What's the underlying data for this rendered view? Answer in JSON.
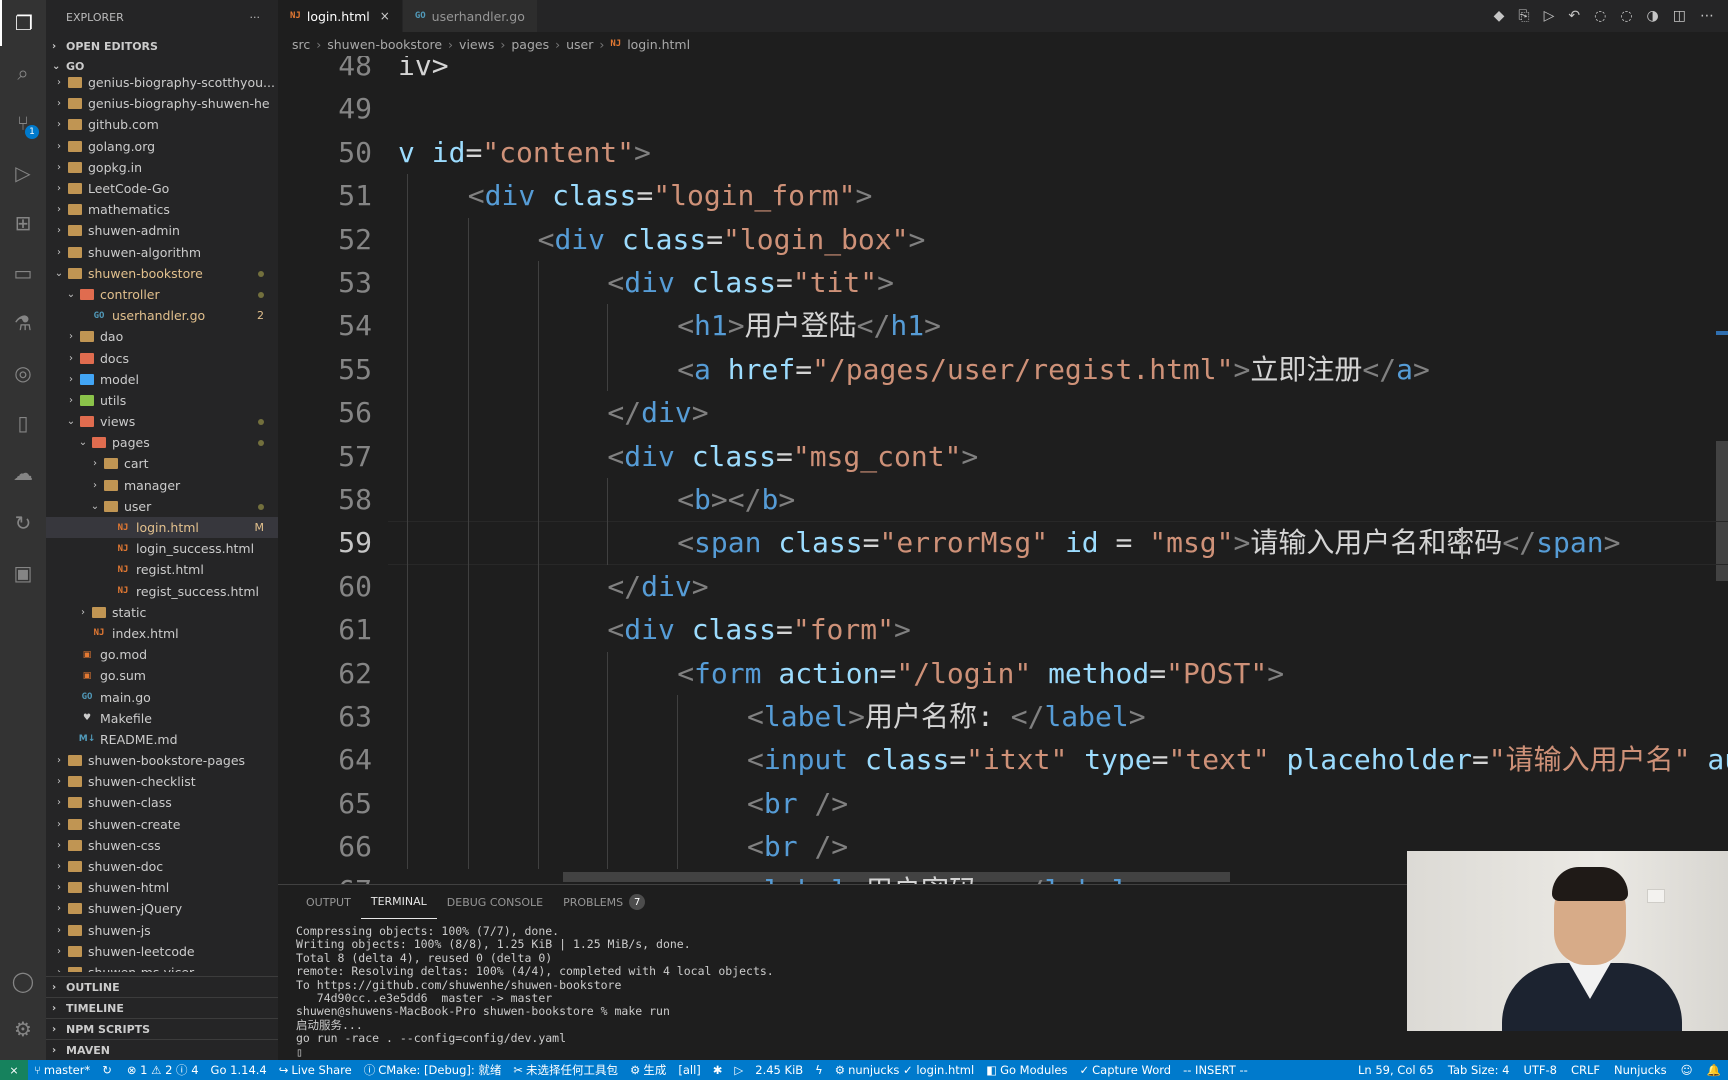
{
  "sidebar": {
    "title": "EXPLORER",
    "more": "···",
    "open_editors": "OPEN EDITORS",
    "workspace": "GO",
    "tree": [
      {
        "name": "genius-biography-scotthyou...",
        "type": "folder",
        "depth": 1,
        "open": false
      },
      {
        "name": "genius-biography-shuwen-he",
        "type": "folder",
        "depth": 1,
        "open": false
      },
      {
        "name": "github.com",
        "type": "folder",
        "depth": 1,
        "open": false
      },
      {
        "name": "golang.org",
        "type": "folder",
        "depth": 1,
        "open": false
      },
      {
        "name": "gopkg.in",
        "type": "folder",
        "depth": 1,
        "open": false
      },
      {
        "name": "LeetCode-Go",
        "type": "folder",
        "depth": 1,
        "open": false
      },
      {
        "name": "mathematics",
        "type": "folder",
        "depth": 1,
        "open": false
      },
      {
        "name": "shuwen-admin",
        "type": "folder",
        "depth": 1,
        "open": false
      },
      {
        "name": "shuwen-algorithm",
        "type": "folder",
        "depth": 1,
        "open": false
      },
      {
        "name": "shuwen-bookstore",
        "type": "folder",
        "depth": 1,
        "open": true,
        "modified": true,
        "deco": "dot"
      },
      {
        "name": "controller",
        "type": "folder-special",
        "depth": 2,
        "open": true,
        "modified": true,
        "deco": "dot"
      },
      {
        "name": "userhandler.go",
        "type": "go",
        "depth": 3,
        "modified": true,
        "deco": "2"
      },
      {
        "name": "dao",
        "type": "folder",
        "depth": 2,
        "open": false
      },
      {
        "name": "docs",
        "type": "folder-special",
        "depth": 2,
        "open": false
      },
      {
        "name": "model",
        "type": "folder-blue",
        "depth": 2,
        "open": false
      },
      {
        "name": "utils",
        "type": "folder-green",
        "depth": 2,
        "open": false
      },
      {
        "name": "views",
        "type": "folder-special",
        "depth": 2,
        "open": true,
        "deco": "dot"
      },
      {
        "name": "pages",
        "type": "folder-special",
        "depth": 3,
        "open": true,
        "deco": "dot"
      },
      {
        "name": "cart",
        "type": "folder",
        "depth": 4,
        "open": false
      },
      {
        "name": "manager",
        "type": "folder",
        "depth": 4,
        "open": false
      },
      {
        "name": "user",
        "type": "folder",
        "depth": 4,
        "open": true,
        "deco": "dot"
      },
      {
        "name": "login.html",
        "type": "html",
        "depth": 5,
        "selected": true,
        "modified": true,
        "deco": "M"
      },
      {
        "name": "login_success.html",
        "type": "html",
        "depth": 5
      },
      {
        "name": "regist.html",
        "type": "html",
        "depth": 5
      },
      {
        "name": "regist_success.html",
        "type": "html",
        "depth": 5
      },
      {
        "name": "static",
        "type": "folder",
        "depth": 3,
        "open": false
      },
      {
        "name": "index.html",
        "type": "html",
        "depth": 3
      },
      {
        "name": "go.mod",
        "type": "gomod",
        "depth": 2
      },
      {
        "name": "go.sum",
        "type": "gomod",
        "depth": 2
      },
      {
        "name": "main.go",
        "type": "go",
        "depth": 2
      },
      {
        "name": "Makefile",
        "type": "make",
        "depth": 2
      },
      {
        "name": "README.md",
        "type": "md",
        "depth": 2
      },
      {
        "name": "shuwen-bookstore-pages",
        "type": "folder",
        "depth": 1,
        "open": false
      },
      {
        "name": "shuwen-checklist",
        "type": "folder",
        "depth": 1,
        "open": false
      },
      {
        "name": "shuwen-class",
        "type": "folder",
        "depth": 1,
        "open": false
      },
      {
        "name": "shuwen-create",
        "type": "folder",
        "depth": 1,
        "open": false
      },
      {
        "name": "shuwen-css",
        "type": "folder",
        "depth": 1,
        "open": false
      },
      {
        "name": "shuwen-doc",
        "type": "folder",
        "depth": 1,
        "open": false
      },
      {
        "name": "shuwen-html",
        "type": "folder",
        "depth": 1,
        "open": false
      },
      {
        "name": "shuwen-jQuery",
        "type": "folder",
        "depth": 1,
        "open": false
      },
      {
        "name": "shuwen-js",
        "type": "folder",
        "depth": 1,
        "open": false
      },
      {
        "name": "shuwen-leetcode",
        "type": "folder",
        "depth": 1,
        "open": false
      },
      {
        "name": "shuwen-ms-vicer",
        "type": "folder",
        "depth": 1,
        "open": false
      }
    ],
    "bottom_sections": [
      "OUTLINE",
      "TIMELINE",
      "NPM SCRIPTS",
      "MAVEN"
    ]
  },
  "activity_badge": "1",
  "tabs": [
    {
      "label": "login.html",
      "icon": "html",
      "active": true,
      "close": "×"
    },
    {
      "label": "userhandler.go",
      "icon": "go",
      "active": false
    }
  ],
  "breadcrumb": [
    "src",
    "shuwen-bookstore",
    "views",
    "pages",
    "user",
    "login.html"
  ],
  "editor": {
    "lines": [
      {
        "n": "48",
        "indent": 0,
        "tokens": [
          [
            "txt",
            "iv>"
          ]
        ]
      },
      {
        "n": "49",
        "indent": 0,
        "tokens": []
      },
      {
        "n": "50",
        "indent": 0,
        "tokens": [
          [
            "attr",
            "v "
          ],
          [
            "attr",
            "id"
          ],
          [
            "txt",
            "="
          ],
          [
            "str",
            "\"content\""
          ],
          [
            "br",
            ">"
          ]
        ]
      },
      {
        "n": "51",
        "indent": 1,
        "tokens": [
          [
            "br",
            "<"
          ],
          [
            "tag",
            "div"
          ],
          [
            "txt",
            " "
          ],
          [
            "attr",
            "class"
          ],
          [
            "txt",
            "="
          ],
          [
            "str",
            "\"login_form\""
          ],
          [
            "br",
            ">"
          ]
        ]
      },
      {
        "n": "52",
        "indent": 2,
        "tokens": [
          [
            "br",
            "<"
          ],
          [
            "tag",
            "div"
          ],
          [
            "txt",
            " "
          ],
          [
            "attr",
            "class"
          ],
          [
            "txt",
            "="
          ],
          [
            "str",
            "\"login_box\""
          ],
          [
            "br",
            ">"
          ]
        ]
      },
      {
        "n": "53",
        "indent": 3,
        "tokens": [
          [
            "br",
            "<"
          ],
          [
            "tag",
            "div"
          ],
          [
            "txt",
            " "
          ],
          [
            "attr",
            "class"
          ],
          [
            "txt",
            "="
          ],
          [
            "str",
            "\"tit\""
          ],
          [
            "br",
            ">"
          ]
        ]
      },
      {
        "n": "54",
        "indent": 4,
        "tokens": [
          [
            "br",
            "<"
          ],
          [
            "tag",
            "h1"
          ],
          [
            "br",
            ">"
          ],
          [
            "txt",
            "用户登陆"
          ],
          [
            "br",
            "</"
          ],
          [
            "tag",
            "h1"
          ],
          [
            "br",
            ">"
          ]
        ]
      },
      {
        "n": "55",
        "indent": 4,
        "tokens": [
          [
            "br",
            "<"
          ],
          [
            "tag",
            "a"
          ],
          [
            "txt",
            " "
          ],
          [
            "attr",
            "href"
          ],
          [
            "txt",
            "="
          ],
          [
            "str",
            "\"/pages/user/regist.html\""
          ],
          [
            "br",
            ">"
          ],
          [
            "txt",
            "立即注册"
          ],
          [
            "br",
            "</"
          ],
          [
            "tag",
            "a"
          ],
          [
            "br",
            ">"
          ]
        ]
      },
      {
        "n": "56",
        "indent": 3,
        "tokens": [
          [
            "br",
            "</"
          ],
          [
            "tag",
            "div"
          ],
          [
            "br",
            ">"
          ]
        ]
      },
      {
        "n": "57",
        "indent": 3,
        "tokens": [
          [
            "br",
            "<"
          ],
          [
            "tag",
            "div"
          ],
          [
            "txt",
            " "
          ],
          [
            "attr",
            "class"
          ],
          [
            "txt",
            "="
          ],
          [
            "str",
            "\"msg_cont\""
          ],
          [
            "br",
            ">"
          ]
        ]
      },
      {
        "n": "58",
        "indent": 4,
        "tokens": [
          [
            "br",
            "<"
          ],
          [
            "tag",
            "b"
          ],
          [
            "br",
            "></"
          ],
          [
            "tag",
            "b"
          ],
          [
            "br",
            ">"
          ]
        ]
      },
      {
        "n": "59",
        "indent": 4,
        "current": true,
        "tokens": [
          [
            "br",
            "<"
          ],
          [
            "tag",
            "span"
          ],
          [
            "txt",
            " "
          ],
          [
            "attr",
            "class"
          ],
          [
            "txt",
            "="
          ],
          [
            "str",
            "\"errorMsg\""
          ],
          [
            "txt",
            " "
          ],
          [
            "attr",
            "id"
          ],
          [
            "txt",
            " = "
          ],
          [
            "str",
            "\"msg\""
          ],
          [
            "br",
            ">"
          ],
          [
            "txt",
            "请输入用户名和密码"
          ],
          [
            "br",
            "</"
          ],
          [
            "tag",
            "span"
          ],
          [
            "br",
            ">"
          ]
        ]
      },
      {
        "n": "60",
        "indent": 3,
        "tokens": [
          [
            "br",
            "</"
          ],
          [
            "tag",
            "div"
          ],
          [
            "br",
            ">"
          ]
        ]
      },
      {
        "n": "61",
        "indent": 3,
        "tokens": [
          [
            "br",
            "<"
          ],
          [
            "tag",
            "div"
          ],
          [
            "txt",
            " "
          ],
          [
            "attr",
            "class"
          ],
          [
            "txt",
            "="
          ],
          [
            "str",
            "\"form\""
          ],
          [
            "br",
            ">"
          ]
        ]
      },
      {
        "n": "62",
        "indent": 4,
        "tokens": [
          [
            "br",
            "<"
          ],
          [
            "tag",
            "form"
          ],
          [
            "txt",
            " "
          ],
          [
            "attr",
            "action"
          ],
          [
            "txt",
            "="
          ],
          [
            "str",
            "\"/login\""
          ],
          [
            "txt",
            " "
          ],
          [
            "attr",
            "method"
          ],
          [
            "txt",
            "="
          ],
          [
            "str",
            "\"POST\""
          ],
          [
            "br",
            ">"
          ]
        ]
      },
      {
        "n": "63",
        "indent": 5,
        "tokens": [
          [
            "br",
            "<"
          ],
          [
            "tag",
            "label"
          ],
          [
            "br",
            ">"
          ],
          [
            "txt",
            "用户名称: "
          ],
          [
            "br",
            "</"
          ],
          [
            "tag",
            "label"
          ],
          [
            "br",
            ">"
          ]
        ]
      },
      {
        "n": "64",
        "indent": 5,
        "tokens": [
          [
            "br",
            "<"
          ],
          [
            "tag",
            "input"
          ],
          [
            "txt",
            " "
          ],
          [
            "attr",
            "class"
          ],
          [
            "txt",
            "="
          ],
          [
            "str",
            "\"itxt\""
          ],
          [
            "txt",
            " "
          ],
          [
            "attr",
            "type"
          ],
          [
            "txt",
            "="
          ],
          [
            "str",
            "\"text\""
          ],
          [
            "txt",
            " "
          ],
          [
            "attr",
            "placeholder"
          ],
          [
            "txt",
            "="
          ],
          [
            "str",
            "\"请输入用户名\""
          ],
          [
            "txt",
            " "
          ],
          [
            "attr",
            "au"
          ]
        ]
      },
      {
        "n": "65",
        "indent": 5,
        "tokens": [
          [
            "br",
            "<"
          ],
          [
            "tag",
            "br"
          ],
          [
            "txt",
            " "
          ],
          [
            "br",
            "/>"
          ]
        ]
      },
      {
        "n": "66",
        "indent": 5,
        "tokens": [
          [
            "br",
            "<"
          ],
          [
            "tag",
            "br"
          ],
          [
            "txt",
            " "
          ],
          [
            "br",
            "/>"
          ]
        ]
      },
      {
        "n": "67",
        "indent": 5,
        "tokens": [
          [
            "br",
            "<"
          ],
          [
            "tag",
            "label"
          ],
          [
            "br",
            ">"
          ],
          [
            "txt",
            "用户密码: "
          ],
          [
            "br",
            "</"
          ],
          [
            "tag",
            "label"
          ],
          [
            "br",
            ">"
          ]
        ]
      }
    ]
  },
  "panel": {
    "tabs": [
      {
        "label": "OUTPUT",
        "active": false
      },
      {
        "label": "TERMINAL",
        "active": true
      },
      {
        "label": "DEBUG CONSOLE",
        "active": false
      },
      {
        "label": "PROBLEMS",
        "active": false,
        "badge": "7"
      }
    ],
    "terminal_lines": [
      "Compressing objects: 100% (7/7), done.",
      "Writing objects: 100% (8/8), 1.25 KiB | 1.25 MiB/s, done.",
      "Total 8 (delta 4), reused 0 (delta 0)",
      "remote: Resolving deltas: 100% (4/4), completed with 4 local objects.",
      "To https://github.com/shuwenhe/shuwen-bookstore",
      "   74d90cc..e3e5dd6  master -> master",
      "shuwen@shuwens-MacBook-Pro shuwen-bookstore % make run",
      "启动服务...",
      "go run -race . --config=config/dev.yaml",
      "▯"
    ]
  },
  "statusbar": {
    "left": [
      {
        "icon": "branch-icon",
        "label": "master*"
      },
      {
        "icon": "sync-icon",
        "label": ""
      },
      {
        "icon": "error-icon",
        "label": "⊗ 1 ⚠ 2 ⓘ 4"
      },
      {
        "icon": "",
        "label": "Go 1.14.4"
      },
      {
        "icon": "live-share-icon",
        "label": "Live Share"
      },
      {
        "icon": "cmake-icon",
        "label": "CMake: [Debug]: 就绪"
      },
      {
        "icon": "kit-icon",
        "label": "未选择任何工具包"
      },
      {
        "icon": "gear-icon",
        "label": "生成"
      },
      {
        "icon": "",
        "label": "[all]"
      },
      {
        "icon": "debug-icon",
        "label": ""
      },
      {
        "icon": "play-icon",
        "label": ""
      },
      {
        "icon": "",
        "label": "2.45 KiB"
      },
      {
        "icon": "lightning-icon",
        "label": ""
      },
      {
        "icon": "nunjucks-icon",
        "label": "nunjucks ✓ login.html"
      },
      {
        "icon": "go-modules-icon",
        "label": "Go Modules"
      },
      {
        "icon": "check-icon",
        "label": "Capture Word"
      },
      {
        "icon": "",
        "label": "-- INSERT --"
      }
    ],
    "right": [
      {
        "label": "Ln 59, Col 65"
      },
      {
        "label": "Tab Size: 4"
      },
      {
        "label": "UTF-8"
      },
      {
        "label": "CRLF"
      },
      {
        "label": "Nunjucks"
      },
      {
        "label": "☺"
      },
      {
        "label": "🔔"
      }
    ]
  },
  "colors": {
    "activity": "#333333",
    "sidebar": "#252526",
    "editor": "#1e1e1e",
    "status": "#007acc",
    "modified": "#e2c08d"
  }
}
